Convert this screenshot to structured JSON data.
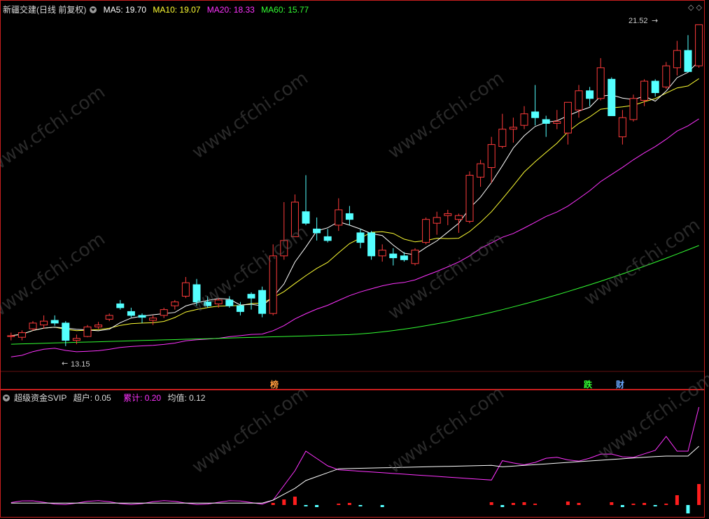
{
  "header": {
    "stock_name": "新疆交建(日线 前复权)",
    "ma5": "MA5: 19.70",
    "ma10": "MA10: 19.07",
    "ma20": "MA20: 18.33",
    "ma60": "MA60: 15.77"
  },
  "indicator": {
    "name": "超级资金SVIP",
    "chaohu": "超户: 0.05",
    "leiji": "累计: 0.20",
    "junzhi": "均值: 0.12"
  },
  "annotations": {
    "high_label": "21.52",
    "low_label": "13.15",
    "badge_bang": "榜",
    "badge_die": "跌",
    "badge_cai": "财"
  },
  "watermark": "www.cfchi.com",
  "colors": {
    "up": "#ff3b3b",
    "down": "#54ffff",
    "ma5": "#ffffff",
    "ma10": "#ffff33",
    "ma20": "#ff33ff",
    "ma60": "#33ff33",
    "frame": "#c81e1e"
  },
  "chart_data": [
    {
      "type": "candlestick",
      "title": "新疆交建(日线 前复权)",
      "ylim": [
        12.6,
        21.8
      ],
      "candles": [
        [
          13.4,
          13.5,
          13.3,
          13.42
        ],
        [
          13.38,
          13.56,
          13.3,
          13.5
        ],
        [
          13.6,
          13.8,
          13.55,
          13.75
        ],
        [
          13.7,
          13.95,
          13.6,
          13.8
        ],
        [
          13.82,
          13.95,
          13.68,
          13.75
        ],
        [
          13.75,
          13.8,
          13.15,
          13.3
        ],
        [
          13.3,
          13.45,
          13.2,
          13.35
        ],
        [
          13.4,
          13.7,
          13.38,
          13.65
        ],
        [
          13.65,
          13.78,
          13.6,
          13.7
        ],
        [
          13.85,
          14.0,
          13.8,
          13.95
        ],
        [
          14.25,
          14.35,
          14.1,
          14.15
        ],
        [
          14.05,
          14.15,
          13.9,
          13.95
        ],
        [
          13.95,
          14.0,
          13.75,
          13.9
        ],
        [
          13.82,
          13.95,
          13.7,
          13.88
        ],
        [
          13.95,
          14.15,
          13.88,
          14.1
        ],
        [
          14.2,
          14.35,
          14.1,
          14.3
        ],
        [
          14.45,
          14.95,
          14.4,
          14.8
        ],
        [
          14.75,
          14.9,
          14.2,
          14.3
        ],
        [
          14.3,
          14.45,
          14.15,
          14.2
        ],
        [
          14.25,
          14.4,
          14.15,
          14.35
        ],
        [
          14.35,
          14.45,
          14.15,
          14.2
        ],
        [
          14.2,
          14.3,
          13.95,
          14.05
        ],
        [
          14.5,
          14.55,
          14.1,
          14.4
        ],
        [
          14.6,
          14.7,
          13.9,
          14.0
        ],
        [
          14.0,
          15.8,
          13.95,
          15.5
        ],
        [
          15.5,
          16.9,
          15.4,
          15.9
        ],
        [
          16.0,
          17.1,
          16.0,
          16.9
        ],
        [
          16.65,
          17.6,
          16.3,
          16.35
        ],
        [
          16.2,
          16.5,
          15.9,
          16.1
        ],
        [
          16.0,
          16.2,
          15.85,
          15.9
        ],
        [
          16.3,
          17.0,
          16.15,
          16.7
        ],
        [
          16.6,
          16.8,
          16.3,
          16.45
        ],
        [
          16.1,
          16.2,
          15.7,
          15.85
        ],
        [
          16.1,
          16.15,
          15.4,
          15.5
        ],
        [
          15.5,
          15.8,
          15.35,
          15.65
        ],
        [
          15.55,
          15.7,
          15.25,
          15.45
        ],
        [
          15.5,
          15.6,
          15.35,
          15.4
        ],
        [
          15.3,
          15.7,
          15.25,
          15.65
        ],
        [
          15.85,
          16.5,
          15.8,
          16.45
        ],
        [
          16.35,
          16.65,
          16.05,
          16.5
        ],
        [
          16.55,
          16.7,
          16.3,
          16.6
        ],
        [
          16.45,
          16.6,
          16.1,
          16.55
        ],
        [
          16.4,
          17.7,
          16.35,
          17.6
        ],
        [
          17.55,
          18.0,
          17.3,
          17.9
        ],
        [
          17.8,
          18.6,
          17.4,
          18.4
        ],
        [
          18.35,
          19.2,
          18.3,
          18.8
        ],
        [
          18.8,
          19.1,
          18.45,
          18.85
        ],
        [
          18.9,
          19.4,
          18.8,
          19.2
        ],
        [
          19.25,
          19.95,
          18.9,
          19.1
        ],
        [
          19.05,
          19.15,
          18.6,
          18.95
        ],
        [
          18.95,
          19.3,
          18.8,
          19.0
        ],
        [
          18.7,
          19.35,
          18.4,
          19.5
        ],
        [
          19.3,
          19.95,
          19.1,
          19.8
        ],
        [
          19.8,
          19.9,
          19.4,
          19.6
        ],
        [
          19.6,
          20.65,
          19.55,
          20.4
        ],
        [
          20.1,
          20.15,
          19.2,
          19.15
        ],
        [
          18.6,
          19.3,
          18.4,
          19.1
        ],
        [
          19.05,
          19.7,
          19.0,
          19.6
        ],
        [
          19.55,
          20.1,
          19.4,
          20.05
        ],
        [
          20.05,
          20.1,
          19.65,
          19.75
        ],
        [
          19.9,
          20.55,
          19.85,
          20.45
        ],
        [
          20.4,
          21.1,
          20.2,
          20.85
        ],
        [
          20.85,
          21.25,
          20.3,
          20.3
        ],
        [
          20.45,
          21.52,
          20.4,
          21.52
        ]
      ],
      "ma5_last": 19.7,
      "ma10_last": 19.07,
      "ma20_last": 18.33,
      "ma60_last": 15.77,
      "high_mark": 21.52,
      "low_mark": 13.15
    },
    {
      "type": "line",
      "title": "超级资金SVIP",
      "series": [
        {
          "name": "累计",
          "color": "#ff33ff"
        },
        {
          "name": "均值",
          "color": "#ffffff"
        },
        {
          "name": "超户",
          "color": "#ff3b3b"
        }
      ],
      "last_values": {
        "超户": 0.05,
        "累计": 0.2,
        "均值": 0.12
      }
    }
  ]
}
